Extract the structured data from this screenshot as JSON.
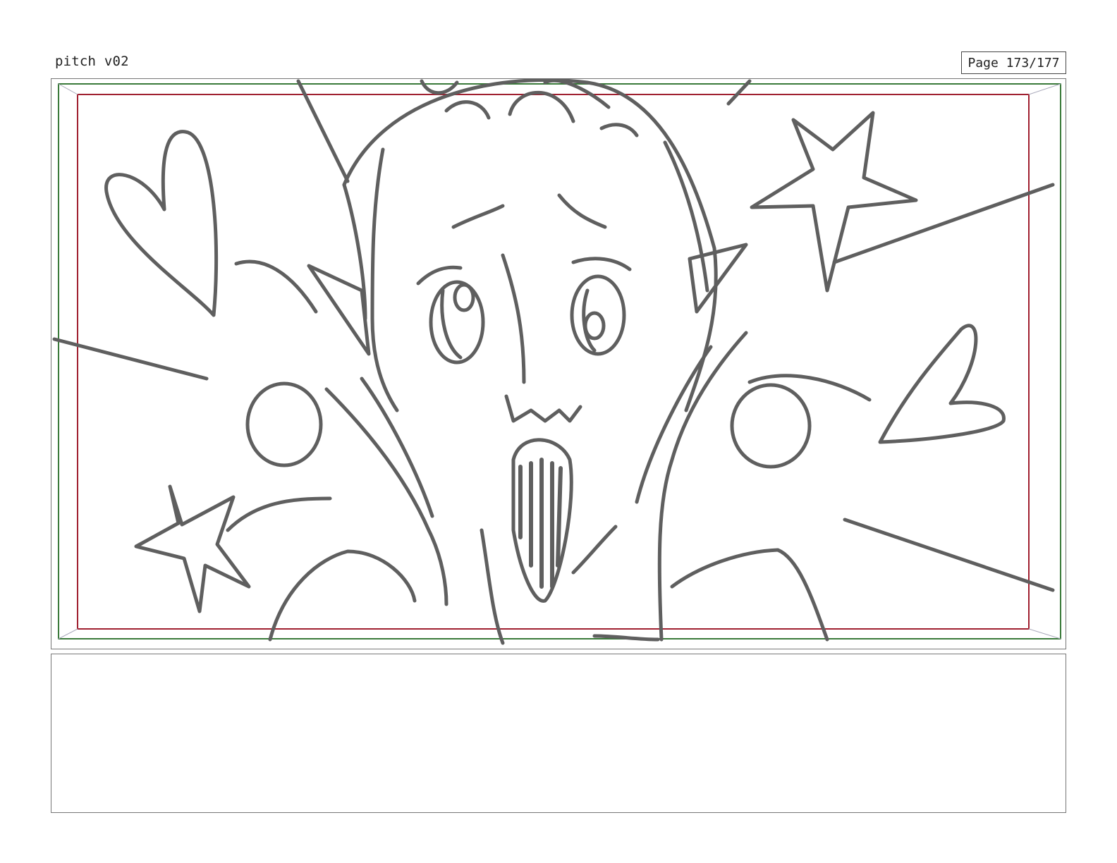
{
  "header": {
    "title": "pitch v02",
    "page_label": "Page 173/177"
  },
  "panel": {
    "safe_area_outer_color": "#3a7a3a",
    "safe_area_inner_color": "#a02030",
    "sketch_color": "#5f5f5f"
  },
  "notes": {
    "text": ""
  }
}
